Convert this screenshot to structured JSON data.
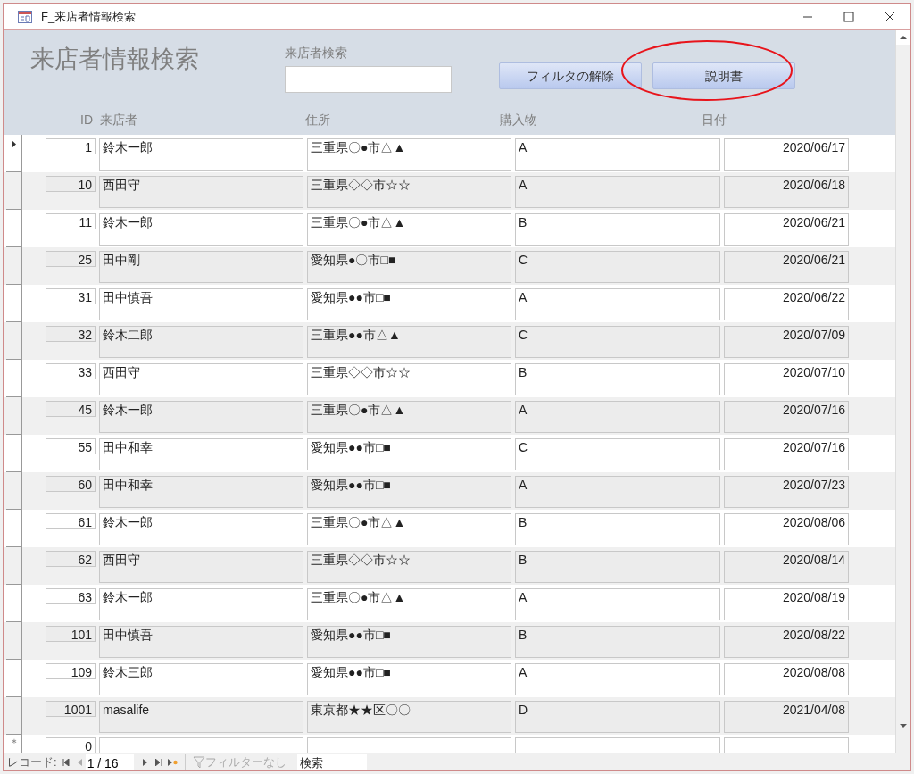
{
  "window": {
    "title": "F_来店者情報検索"
  },
  "header": {
    "title": "来店者情報検索",
    "search": {
      "label": "来店者検索"
    },
    "buttons": [
      {
        "label": "フィルタの解除",
        "circled": false
      },
      {
        "label": "説明書",
        "circled": true
      }
    ]
  },
  "table": {
    "columns": [
      "ID",
      "来店者",
      "住所",
      "購入物",
      "日付"
    ],
    "rows": [
      {
        "id": "1",
        "name": "鈴木一郎",
        "address": "三重県〇●市△▲",
        "item": "A",
        "date": "2020/06/17",
        "selected": true
      },
      {
        "id": "10",
        "name": "西田守",
        "address": "三重県◇◇市☆☆",
        "item": "A",
        "date": "2020/06/18",
        "selected": false
      },
      {
        "id": "11",
        "name": "鈴木一郎",
        "address": "三重県〇●市△▲",
        "item": "B",
        "date": "2020/06/21",
        "selected": false
      },
      {
        "id": "25",
        "name": "田中剛",
        "address": "愛知県●〇市□■",
        "item": "C",
        "date": "2020/06/21",
        "selected": false
      },
      {
        "id": "31",
        "name": "田中慎吾",
        "address": "愛知県●●市□■",
        "item": "A",
        "date": "2020/06/22",
        "selected": false
      },
      {
        "id": "32",
        "name": "鈴木二郎",
        "address": "三重県●●市△▲",
        "item": "C",
        "date": "2020/07/09",
        "selected": false
      },
      {
        "id": "33",
        "name": "西田守",
        "address": "三重県◇◇市☆☆",
        "item": "B",
        "date": "2020/07/10",
        "selected": false
      },
      {
        "id": "45",
        "name": "鈴木一郎",
        "address": "三重県〇●市△▲",
        "item": "A",
        "date": "2020/07/16",
        "selected": false
      },
      {
        "id": "55",
        "name": "田中和幸",
        "address": "愛知県●●市□■",
        "item": "C",
        "date": "2020/07/16",
        "selected": false
      },
      {
        "id": "60",
        "name": "田中和幸",
        "address": "愛知県●●市□■",
        "item": "A",
        "date": "2020/07/23",
        "selected": false
      },
      {
        "id": "61",
        "name": "鈴木一郎",
        "address": "三重県〇●市△▲",
        "item": "B",
        "date": "2020/08/06",
        "selected": false
      },
      {
        "id": "62",
        "name": "西田守",
        "address": "三重県◇◇市☆☆",
        "item": "B",
        "date": "2020/08/14",
        "selected": false
      },
      {
        "id": "63",
        "name": "鈴木一郎",
        "address": "三重県〇●市△▲",
        "item": "A",
        "date": "2020/08/19",
        "selected": false
      },
      {
        "id": "101",
        "name": "田中慎吾",
        "address": "愛知県●●市□■",
        "item": "B",
        "date": "2020/08/22",
        "selected": false
      },
      {
        "id": "109",
        "name": "鈴木三郎",
        "address": "愛知県●●市□■",
        "item": "A",
        "date": "2020/08/08",
        "selected": false
      },
      {
        "id": "1001",
        "name": "masalife",
        "address": "東京都★★区〇〇",
        "item": "D",
        "date": "2021/04/08",
        "selected": false
      }
    ],
    "new_row": {
      "marker": "＊",
      "id": "0"
    }
  },
  "navigation": {
    "label": "レコード:",
    "position": "1 / 16",
    "filter": "フィルターなし",
    "search": "検索"
  }
}
